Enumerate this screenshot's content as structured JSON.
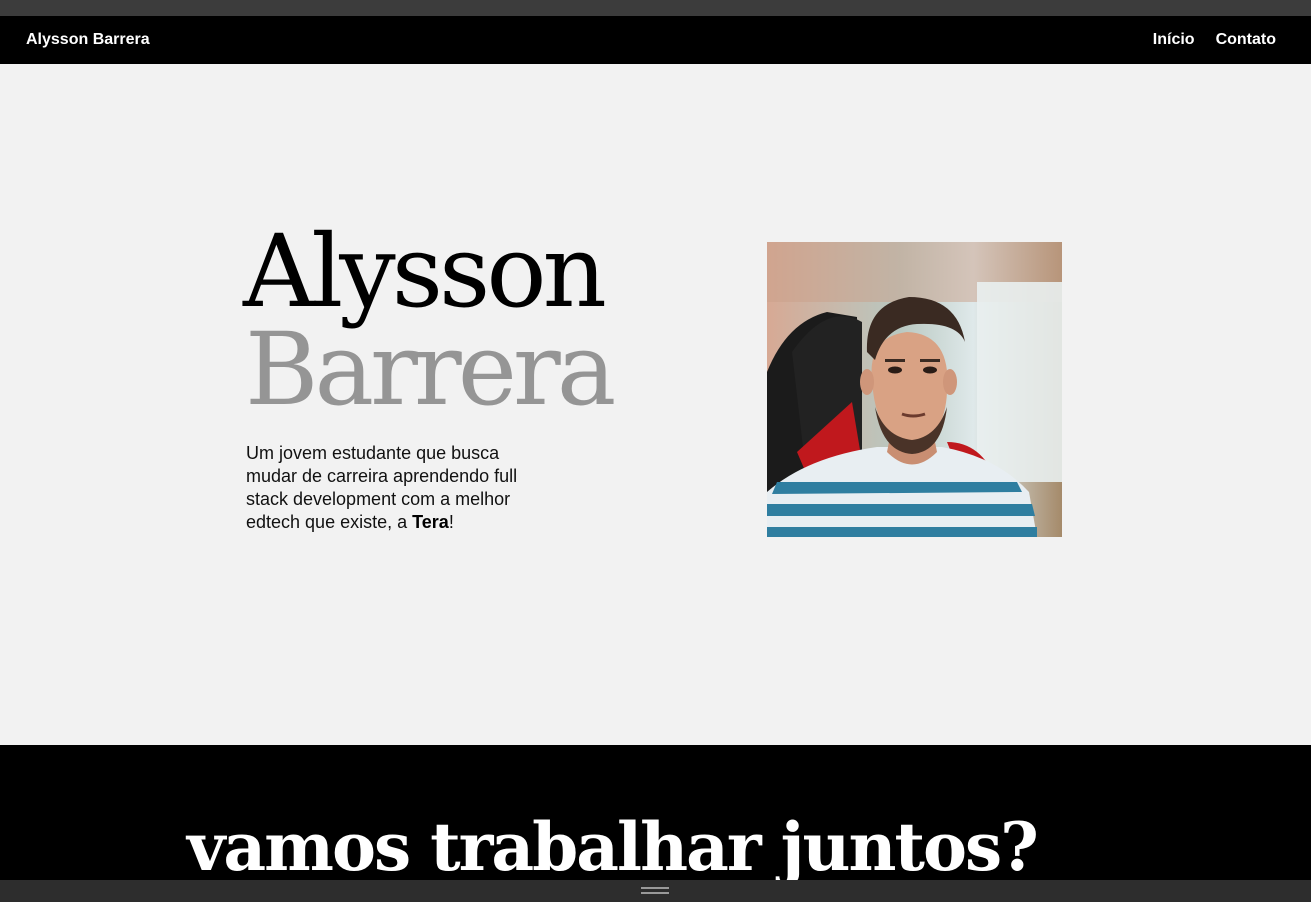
{
  "nav": {
    "brand": "Alysson Barrera",
    "links": [
      "Início",
      "Contato"
    ]
  },
  "hero": {
    "first_name": "Alysson",
    "last_name": "Barrera",
    "description_start": "Um jovem estudante que busca mudar de carreira aprendendo full stack development com a melhor edtech que existe, a ",
    "description_bold": "Tera",
    "description_end": "!",
    "photo_alt": "Foto de Alysson Barrera"
  },
  "cta": {
    "heading": "vamos trabalhar juntos?"
  },
  "colors": {
    "nav_bg": "#000000",
    "hero_bg": "#f2f2f2",
    "last_name": "#959595",
    "cta_bg": "#000000"
  }
}
